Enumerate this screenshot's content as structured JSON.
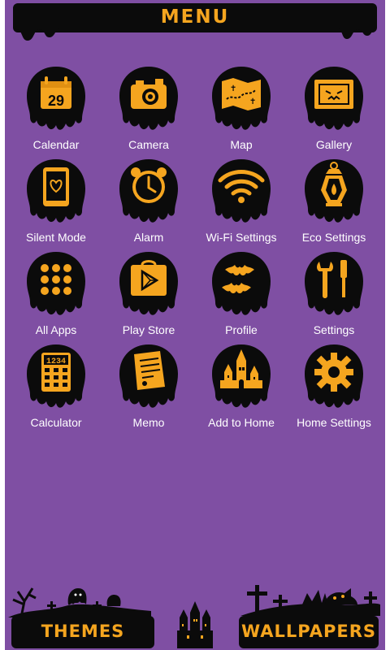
{
  "header": {
    "title": "MENU"
  },
  "apps": [
    {
      "label": "Calendar",
      "icon": "calendar-icon",
      "day": "29"
    },
    {
      "label": "Camera",
      "icon": "camera-icon"
    },
    {
      "label": "Map",
      "icon": "map-icon"
    },
    {
      "label": "Gallery",
      "icon": "gallery-icon"
    },
    {
      "label": "Silent Mode",
      "icon": "silent-mode-icon"
    },
    {
      "label": "Alarm",
      "icon": "alarm-icon"
    },
    {
      "label": "Wi-Fi Settings",
      "icon": "wifi-icon"
    },
    {
      "label": "Eco Settings",
      "icon": "lantern-icon"
    },
    {
      "label": "All Apps",
      "icon": "all-apps-icon"
    },
    {
      "label": "Play Store",
      "icon": "play-store-icon"
    },
    {
      "label": "Profile",
      "icon": "bats-icon"
    },
    {
      "label": "Settings",
      "icon": "wrench-screwdriver-icon"
    },
    {
      "label": "Calculator",
      "icon": "calculator-icon",
      "display": "1234"
    },
    {
      "label": "Memo",
      "icon": "memo-icon"
    },
    {
      "label": "Add to Home",
      "icon": "castle-icon"
    },
    {
      "label": "Home Settings",
      "icon": "gear-icon"
    }
  ],
  "bottom": {
    "themes_label": "THEMES",
    "wallpapers_label": "WALLPAPERS"
  },
  "colors": {
    "background": "#7f4fa3",
    "accent": "#f5a51f",
    "ink": "#0b0b0b",
    "text": "#ffffff"
  }
}
